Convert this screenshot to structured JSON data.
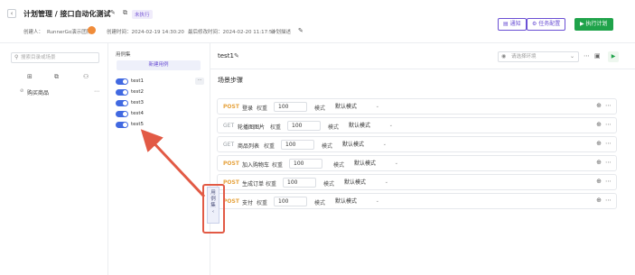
{
  "header": {
    "back_glyph": "‹",
    "title": "计划管理 / 接口自动化测试",
    "status_badge": "未执行",
    "creator_label": "创建人：",
    "creator_name": "RunnerGo演示团队",
    "created_at": "创建时间：2024-02-19 14:30:20",
    "updated_at": "最后修改时间：2024-02-20 11:17:59",
    "plan_desc_label": "计划描述",
    "buttons": {
      "notify": "通知",
      "task_config": "任务配置",
      "run_plan": "执行计划"
    }
  },
  "left_panel": {
    "search_placeholder": "搜索目录或场景",
    "tree": [
      {
        "label": "购买商品",
        "more": "⋯"
      }
    ]
  },
  "case_panel": {
    "title": "用例集",
    "new_case_button": "新建用例",
    "cases": [
      {
        "label": "test1",
        "enabled": true,
        "more": "···"
      },
      {
        "label": "test2",
        "enabled": true
      },
      {
        "label": "test3",
        "enabled": true
      },
      {
        "label": "test4",
        "enabled": true
      },
      {
        "label": "test5",
        "enabled": true
      }
    ]
  },
  "main": {
    "scene_name": "test1",
    "env_placeholder": "请选择环境",
    "section_title": "场景步骤",
    "steps": [
      {
        "method": "POST",
        "name": "登录",
        "weight_label": "权重",
        "weight": "100",
        "mode_label": "模式",
        "mode": "默认模式"
      },
      {
        "method": "GET",
        "name": "轮播图图片",
        "weight_label": "权重",
        "weight": "100",
        "mode_label": "模式",
        "mode": "默认模式"
      },
      {
        "method": "GET",
        "name": "商品列表",
        "weight_label": "权重",
        "weight": "100",
        "mode_label": "模式",
        "mode": "默认模式"
      },
      {
        "method": "POST",
        "name": "加入购物车",
        "weight_label": "权重",
        "weight": "100",
        "mode_label": "模式",
        "mode": "默认模式"
      },
      {
        "method": "POST",
        "name": "生成订单",
        "weight_label": "权重",
        "weight": "100",
        "mode_label": "模式",
        "mode": "默认模式"
      },
      {
        "method": "POST",
        "name": "支付",
        "weight_label": "权重",
        "weight": "100",
        "mode_label": "模式",
        "mode": "默认模式"
      }
    ]
  },
  "collapse_tab": {
    "line1": "用",
    "line2": "例",
    "line3": "集",
    "chevron": "‹"
  },
  "colors": {
    "accent": "#6a4fd4",
    "run_green": "#1fa34a",
    "toggle_blue": "#4169e1",
    "post_orange": "#e6a23c",
    "highlight_red": "#e25a45"
  }
}
